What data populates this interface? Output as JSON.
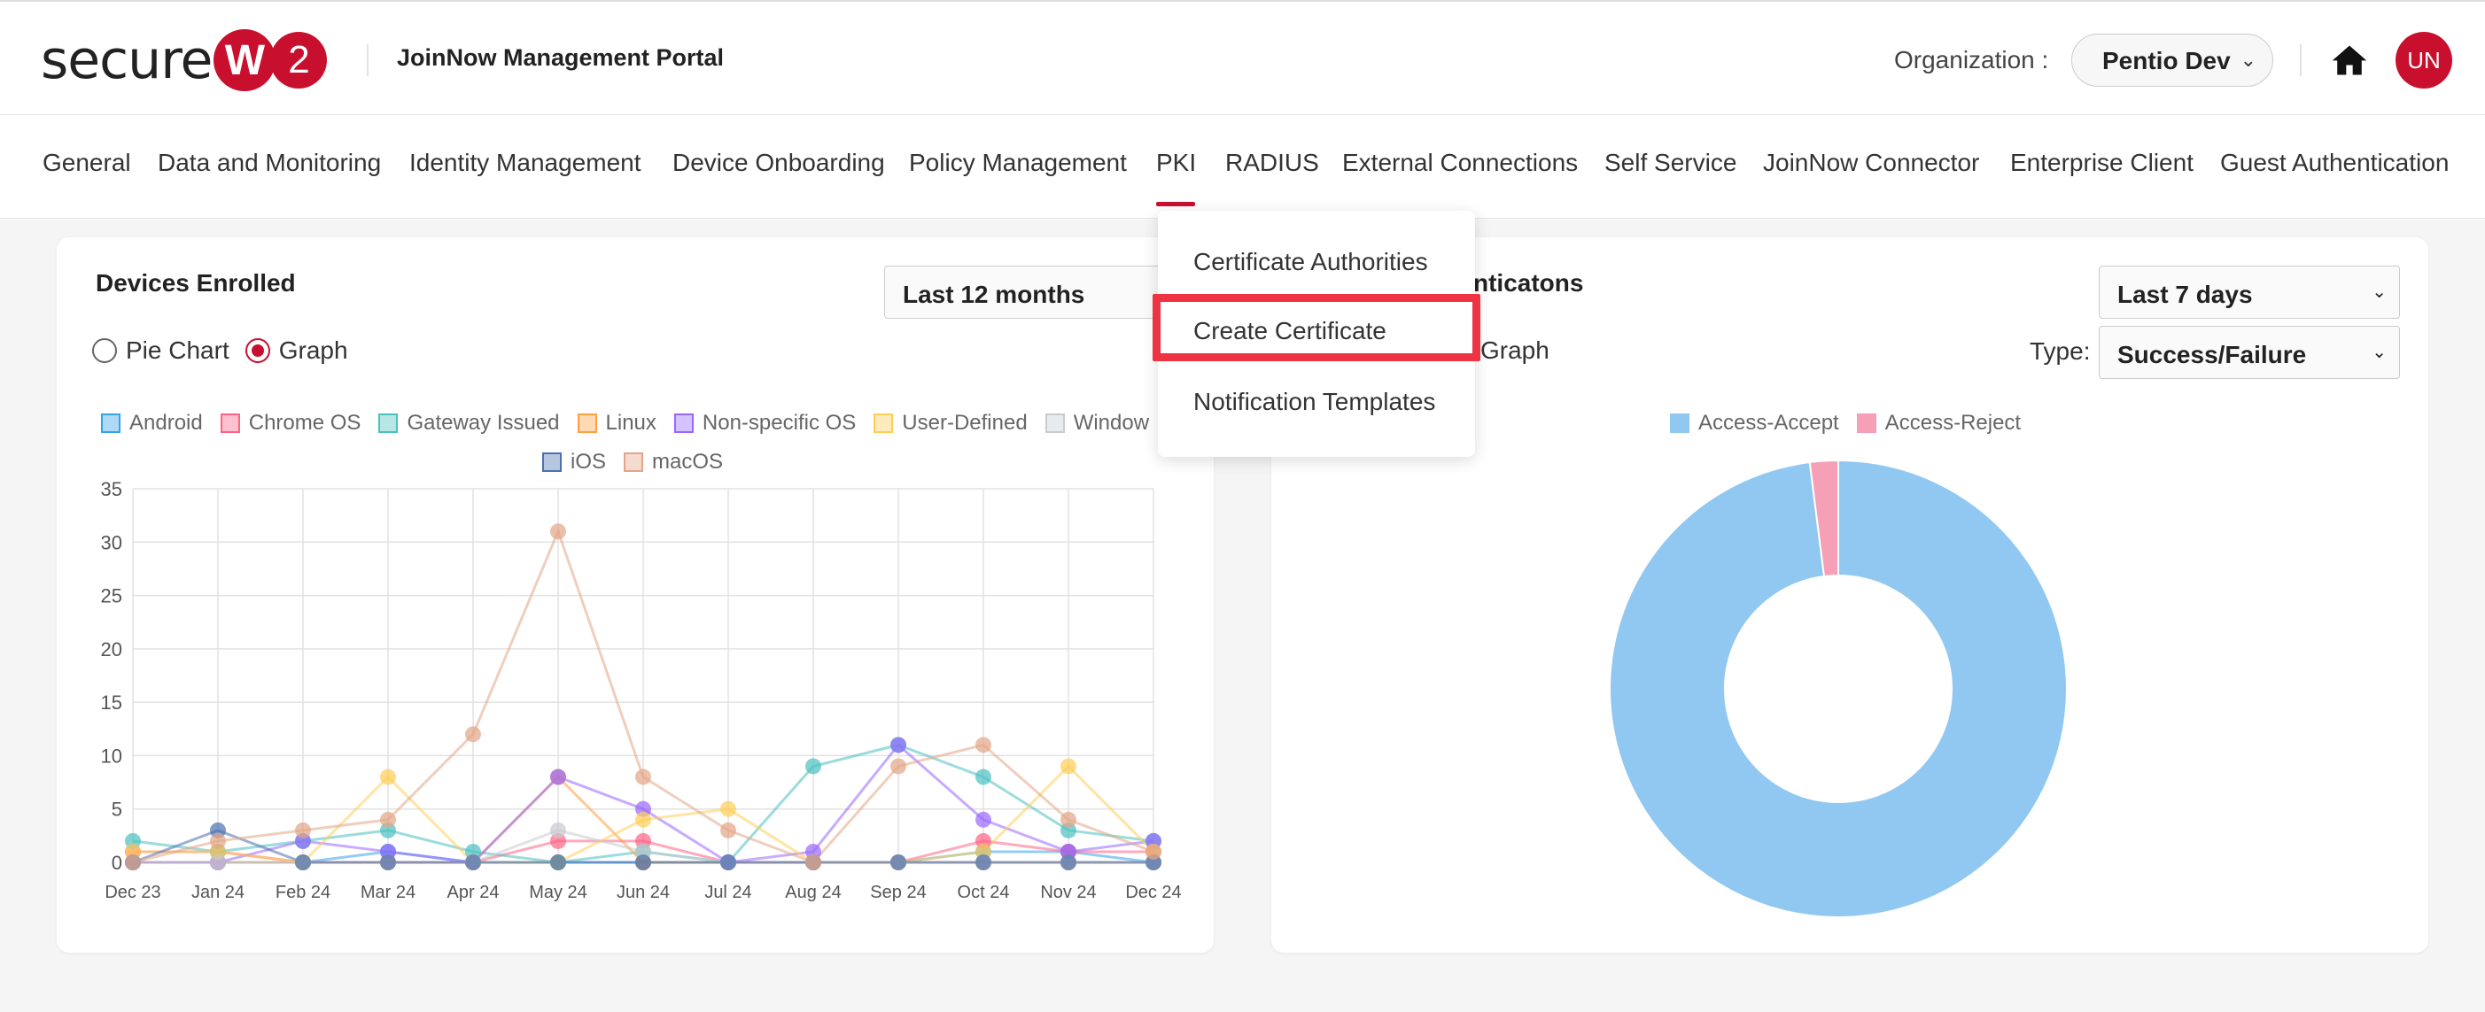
{
  "header": {
    "logo_text": "secure",
    "logo_w": "W",
    "logo_2": "2",
    "portal_title": "JoinNow Management Portal",
    "org_label": "Organization :",
    "org_value": "Pentio Dev",
    "avatar_initials": "UN"
  },
  "nav": {
    "items": [
      {
        "label": "General"
      },
      {
        "label": "Data and Monitoring"
      },
      {
        "label": "Identity Management"
      },
      {
        "label": "Device Onboarding"
      },
      {
        "label": "Policy Management"
      },
      {
        "label": "PKI"
      },
      {
        "label": "RADIUS"
      },
      {
        "label": "External Connections"
      },
      {
        "label": "Self Service"
      },
      {
        "label": "JoinNow Connector"
      },
      {
        "label": "Enterprise Client"
      },
      {
        "label": "Guest Authentication"
      }
    ],
    "active": "PKI"
  },
  "pki_menu": {
    "items": [
      {
        "label": "Certificate Authorities"
      },
      {
        "label": "Create Certificate"
      },
      {
        "label": "Notification Templates"
      }
    ],
    "highlighted": "Create Certificate"
  },
  "devices_card": {
    "title": "Devices Enrolled",
    "range_value": "Last 12 months",
    "radio_pie": "Pie Chart",
    "radio_graph": "Graph",
    "selected_view": "Graph"
  },
  "auth_card": {
    "title_visible": "nticatons",
    "range_value": "Last 7 days",
    "radio_graph": "Graph",
    "type_label": "Type:",
    "type_value": "Success/Failure"
  },
  "chart_data": [
    {
      "type": "line",
      "x": [
        "Dec 23",
        "Jan 24",
        "Feb 24",
        "Mar 24",
        "Apr 24",
        "May 24",
        "Jun 24",
        "Jul 24",
        "Aug 24",
        "Sep 24",
        "Oct 24",
        "Nov 24",
        "Dec 24"
      ],
      "ylim": [
        0,
        35
      ],
      "yticks": [
        0,
        5,
        10,
        15,
        20,
        25,
        30,
        35
      ],
      "grid": true,
      "legend_position": "top",
      "series": [
        {
          "name": "Android",
          "color": "#36a2eb",
          "values": [
            0,
            0,
            0,
            1,
            0,
            0,
            0,
            0,
            0,
            0,
            1,
            1,
            0
          ]
        },
        {
          "name": "Chrome OS",
          "color": "#ff6384",
          "values": [
            1,
            1,
            0,
            0,
            0,
            2,
            2,
            0,
            0,
            0,
            2,
            1,
            1
          ]
        },
        {
          "name": "Gateway Issued",
          "color": "#4bc0c0",
          "values": [
            2,
            1,
            2,
            3,
            1,
            0,
            1,
            0,
            9,
            11,
            8,
            3,
            2
          ]
        },
        {
          "name": "Linux",
          "color": "#ff9f40",
          "values": [
            0,
            0,
            0,
            0,
            0,
            8,
            0,
            0,
            0,
            0,
            0,
            0,
            0
          ]
        },
        {
          "name": "Non-specific OS",
          "color": "#9966ff",
          "values": [
            0,
            0,
            2,
            1,
            0,
            8,
            5,
            0,
            1,
            11,
            4,
            1,
            2
          ]
        },
        {
          "name": "User-Defined",
          "color": "#ffcd56",
          "values": [
            1,
            1,
            0,
            8,
            0,
            0,
            4,
            5,
            0,
            0,
            1,
            9,
            1
          ]
        },
        {
          "name": "Window",
          "color": "#c9cbcf",
          "values": [
            0,
            0,
            0,
            0,
            0,
            3,
            1,
            0,
            0,
            0,
            0,
            0,
            0
          ]
        },
        {
          "name": "iOS",
          "color": "#4a70b0",
          "values": [
            0,
            3,
            0,
            0,
            0,
            0,
            0,
            0,
            0,
            0,
            0,
            0,
            0
          ]
        },
        {
          "name": "macOS",
          "color": "#e3a586",
          "values": [
            0,
            2,
            3,
            4,
            12,
            31,
            8,
            3,
            0,
            9,
            11,
            4,
            1
          ]
        }
      ]
    },
    {
      "type": "pie",
      "style": "doughnut",
      "legend_position": "top",
      "slices": [
        {
          "name": "Access-Accept",
          "color": "#90c8f2",
          "value": 98
        },
        {
          "name": "Access-Reject",
          "color": "#f5a0b6",
          "value": 2
        }
      ]
    }
  ]
}
